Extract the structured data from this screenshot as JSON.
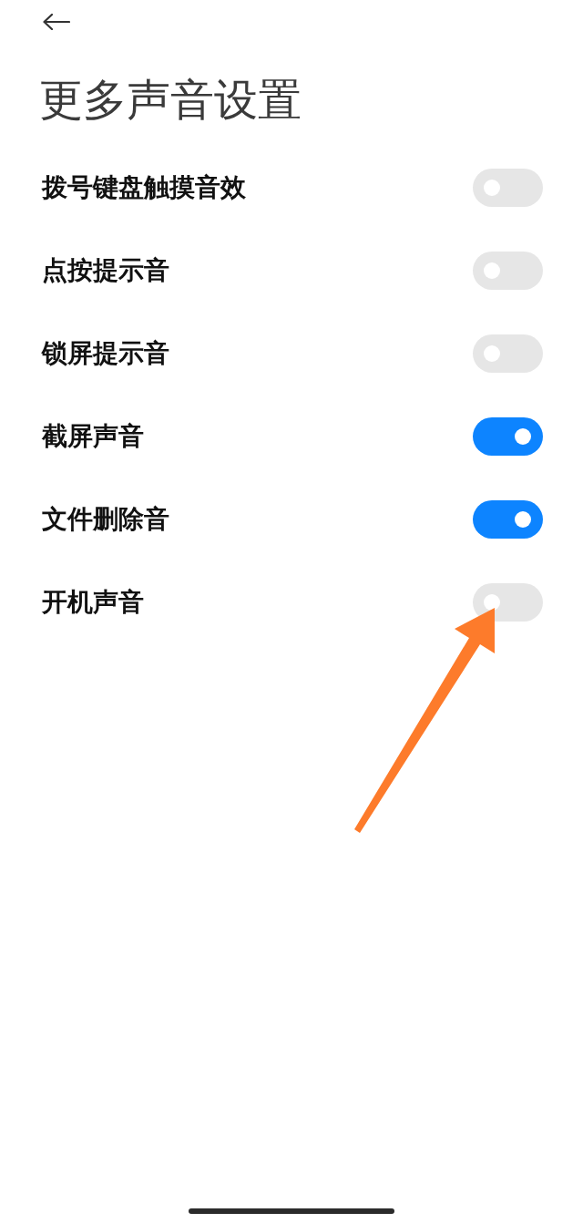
{
  "title": "更多声音设置",
  "settings": [
    {
      "label": "拨号键盘触摸音效",
      "on": false
    },
    {
      "label": "点按提示音",
      "on": false
    },
    {
      "label": "锁屏提示音",
      "on": false
    },
    {
      "label": "截屏声音",
      "on": true
    },
    {
      "label": "文件删除音",
      "on": true
    },
    {
      "label": "开机声音",
      "on": false
    }
  ],
  "annotations": [
    {
      "kind": "arrow"
    }
  ],
  "home_indicator": true
}
